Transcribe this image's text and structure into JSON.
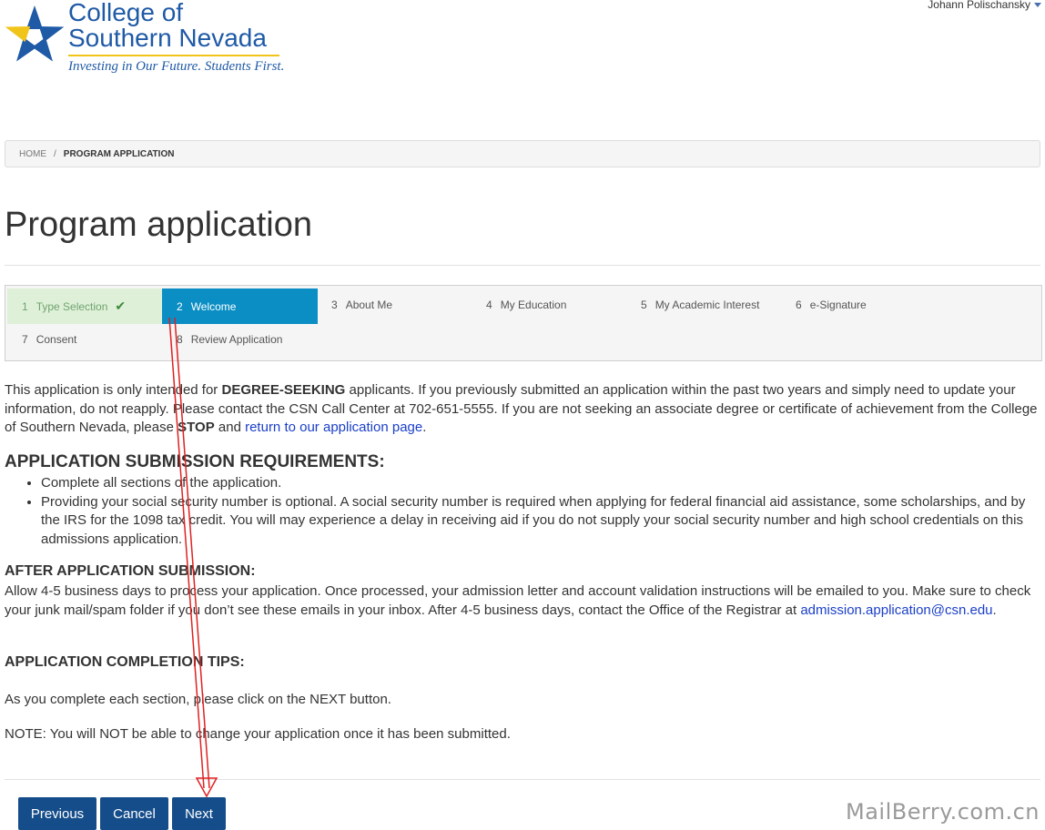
{
  "logo": {
    "line1": "College of",
    "line2": "Southern Nevada",
    "tagline": "Investing in Our Future. Students First."
  },
  "user": {
    "name": "Johann Polischansky"
  },
  "breadcrumb": {
    "home": "HOME",
    "separator": "/",
    "current": "PROGRAM APPLICATION"
  },
  "page": {
    "title": "Program application"
  },
  "steps": [
    {
      "num": "1",
      "label": "Type Selection",
      "state": "done"
    },
    {
      "num": "2",
      "label": "Welcome",
      "state": "active"
    },
    {
      "num": "3",
      "label": "About Me",
      "state": "todo"
    },
    {
      "num": "4",
      "label": "My Education",
      "state": "todo"
    },
    {
      "num": "5",
      "label": "My Academic Interest",
      "state": "todo"
    },
    {
      "num": "6",
      "label": "e-Signature",
      "state": "todo"
    },
    {
      "num": "7",
      "label": "Consent",
      "state": "todo"
    },
    {
      "num": "8",
      "label": "Review Application",
      "state": "todo"
    }
  ],
  "intro": {
    "part1": "This application is only intended for ",
    "bold1": "DEGREE-SEEKING",
    "part2": " applicants. If you previously submitted an application within the past two years and simply need to update your information, do not reapply. Please contact the CSN Call Center at 702-651-5555. If you are not seeking an associate degree or certificate of achievement from the College of Southern Nevada, please ",
    "bold2": "STOP",
    "part3": " and ",
    "link": "return to our application page",
    "part4": "."
  },
  "requirements": {
    "heading": "APPLICATION SUBMISSION REQUIREMENTS:",
    "items": [
      "Complete all sections of the application.",
      "Providing your social security number is optional. A social security number is required when applying for federal financial aid assistance, some scholarships, and by the IRS for the 1098 tax credit. You will may experience a delay in receiving aid if you do not supply your social security number and high school credentials on this admissions application."
    ]
  },
  "after": {
    "heading": "AFTER APPLICATION SUBMISSION:",
    "text": "Allow 4-5 business days to process your application. Once processed, your admission letter and account validation instructions will be emailed to you. Make sure to check your junk mail/spam folder if you don’t see these emails in your inbox. After 4-5 business days, contact the Office of the Registrar at ",
    "email": "admission.application@csn.edu",
    "end": "."
  },
  "tips": {
    "heading": "APPLICATION COMPLETION TIPS:",
    "line1": "As you complete each section, please click on the NEXT button.",
    "line2": "NOTE: You will NOT be able to change your application once it has been submitted."
  },
  "buttons": {
    "previous": "Previous",
    "cancel": "Cancel",
    "next": "Next"
  },
  "watermark": "MailBerry.com.cn",
  "colors": {
    "brand": "#1f5aa6",
    "active_step": "#0a8ec4",
    "done_step": "#dff0d8",
    "button": "#154d8a",
    "annotation": "#e02020"
  }
}
